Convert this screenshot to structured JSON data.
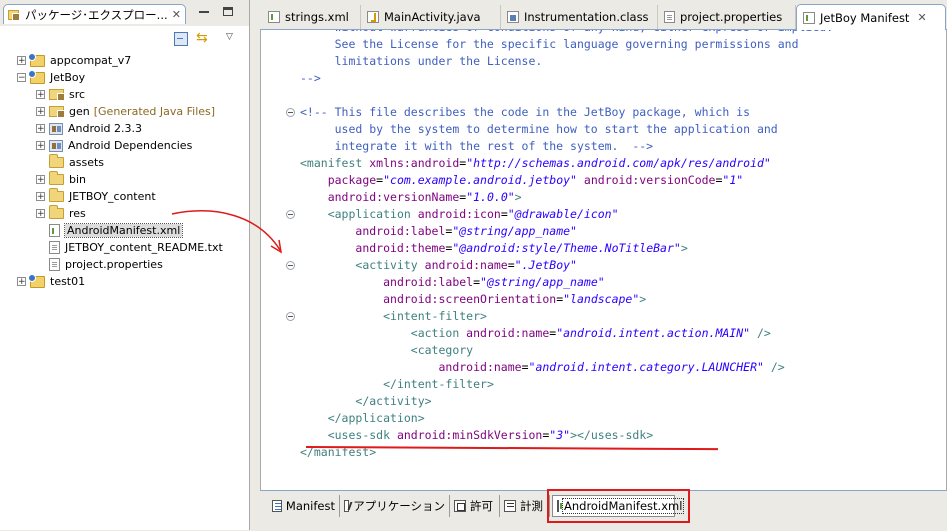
{
  "explorer": {
    "tab_title": "パッケージ･エクスプロー...",
    "tree": [
      {
        "label": "appcompat_v7",
        "kind": "project",
        "depth": 0,
        "expander": "+"
      },
      {
        "label": "JetBoy",
        "kind": "project",
        "depth": 0,
        "expander": "−"
      },
      {
        "label": "src",
        "kind": "pkgfolder",
        "depth": 1,
        "expander": "+"
      },
      {
        "label": "gen",
        "suffix": "[Generated Java Files]",
        "kind": "pkgfolder",
        "depth": 1,
        "expander": "+"
      },
      {
        "label": "Android 2.3.3",
        "kind": "library",
        "depth": 1,
        "expander": "+"
      },
      {
        "label": "Android Dependencies",
        "kind": "library",
        "depth": 1,
        "expander": "+"
      },
      {
        "label": "assets",
        "kind": "folder",
        "depth": 1,
        "expander": ""
      },
      {
        "label": "bin",
        "kind": "folder",
        "depth": 1,
        "expander": "+"
      },
      {
        "label": "JETBOY_content",
        "kind": "folder",
        "depth": 1,
        "expander": "+"
      },
      {
        "label": "res",
        "kind": "folder",
        "depth": 1,
        "expander": "+"
      },
      {
        "label": "AndroidManifest.xml",
        "kind": "xmlfile",
        "depth": 1,
        "expander": "",
        "selected": true
      },
      {
        "label": "JETBOY_content_README.txt",
        "kind": "file",
        "depth": 1,
        "expander": ""
      },
      {
        "label": "project.properties",
        "kind": "file",
        "depth": 1,
        "expander": ""
      },
      {
        "label": "test01",
        "kind": "project",
        "depth": 0,
        "expander": "+"
      }
    ]
  },
  "editor": {
    "tabs": [
      {
        "label": "strings.xml",
        "icon": "xml-file-icon"
      },
      {
        "label": "MainActivity.java",
        "icon": "java-file-icon"
      },
      {
        "label": "Instrumentation.class",
        "icon": "class-file-icon"
      },
      {
        "label": "project.properties",
        "icon": "properties-file-icon"
      },
      {
        "label": "JetBoy Manifest",
        "icon": "xml-file-icon",
        "active": true
      }
    ],
    "close_glyph": "✕",
    "bottom_tabs": [
      {
        "label": "Manifest",
        "icon": "manifest"
      },
      {
        "label": "アプリケーション",
        "icon": "application"
      },
      {
        "label": "許可",
        "icon": "permission"
      },
      {
        "label": "計測",
        "icon": "instrumentation"
      },
      {
        "label": "AndroidManifest.xml",
        "icon": "xml",
        "active": true
      }
    ]
  },
  "code_lines": [
    [
      [
        "c-com",
        "     without warranties or conditions of any kind, either express or implied."
      ]
    ],
    [
      [
        "c-com",
        "     See the License for the specific language governing permissions and"
      ]
    ],
    [
      [
        "c-com",
        "     limitations under the License."
      ]
    ],
    [
      [
        "c-com",
        "-->"
      ]
    ],
    [],
    [
      [
        "c-com",
        "<!-- This file describes the code in the JetBoy package, which is"
      ]
    ],
    [
      [
        "c-com",
        "     used by the system to determine how to start the application and"
      ]
    ],
    [
      [
        "c-com",
        "     integrate it with the rest of the system.  -->"
      ]
    ],
    [
      [
        "c-tag",
        "<manifest "
      ],
      [
        "c-attr",
        "xmlns:android"
      ],
      [
        "c-eq",
        "="
      ],
      [
        "c-val",
        "\"http://schemas.android.com/apk/res/android\""
      ]
    ],
    [
      [
        "",
        "    "
      ],
      [
        "c-attr",
        "package"
      ],
      [
        "c-eq",
        "="
      ],
      [
        "c-val",
        "\"com.example.android.jetboy\""
      ],
      [
        "",
        " "
      ],
      [
        "c-attr",
        "android:versionCode"
      ],
      [
        "c-eq",
        "="
      ],
      [
        "c-val",
        "\"1\""
      ]
    ],
    [
      [
        "",
        "    "
      ],
      [
        "c-attr",
        "android:versionName"
      ],
      [
        "c-eq",
        "="
      ],
      [
        "c-val",
        "\"1.0.0\""
      ],
      [
        "c-tag",
        ">"
      ]
    ],
    [
      [
        "",
        "    "
      ],
      [
        "c-tag",
        "<application "
      ],
      [
        "c-attr",
        "android:icon"
      ],
      [
        "c-eq",
        "="
      ],
      [
        "c-val",
        "\"@drawable/icon\""
      ]
    ],
    [
      [
        "",
        "        "
      ],
      [
        "c-attr",
        "android:label"
      ],
      [
        "c-eq",
        "="
      ],
      [
        "c-val",
        "\"@string/app_name\""
      ]
    ],
    [
      [
        "",
        "        "
      ],
      [
        "c-attr",
        "android:theme"
      ],
      [
        "c-eq",
        "="
      ],
      [
        "c-val",
        "\"@android:style/Theme.NoTitleBar\""
      ],
      [
        "c-tag",
        ">"
      ]
    ],
    [
      [
        "",
        "        "
      ],
      [
        "c-tag",
        "<activity "
      ],
      [
        "c-attr",
        "android:name"
      ],
      [
        "c-eq",
        "="
      ],
      [
        "c-val",
        "\".JetBoy\""
      ]
    ],
    [
      [
        "",
        "            "
      ],
      [
        "c-attr",
        "android:label"
      ],
      [
        "c-eq",
        "="
      ],
      [
        "c-val",
        "\"@string/app_name\""
      ]
    ],
    [
      [
        "",
        "            "
      ],
      [
        "c-attr",
        "android:screenOrientation"
      ],
      [
        "c-eq",
        "="
      ],
      [
        "c-val",
        "\"landscape\""
      ],
      [
        "c-tag",
        ">"
      ]
    ],
    [
      [
        "",
        "            "
      ],
      [
        "c-tag",
        "<intent-filter>"
      ]
    ],
    [
      [
        "",
        "                "
      ],
      [
        "c-tag",
        "<action "
      ],
      [
        "c-attr",
        "android:name"
      ],
      [
        "c-eq",
        "="
      ],
      [
        "c-val",
        "\"android.intent.action.MAIN\""
      ],
      [
        "c-tag",
        " />"
      ]
    ],
    [
      [
        "",
        "                "
      ],
      [
        "c-tag",
        "<category"
      ]
    ],
    [
      [
        "",
        "                    "
      ],
      [
        "c-attr",
        "android:name"
      ],
      [
        "c-eq",
        "="
      ],
      [
        "c-val",
        "\"android.intent.category.LAUNCHER\""
      ],
      [
        "c-tag",
        " />"
      ]
    ],
    [
      [
        "",
        "            "
      ],
      [
        "c-tag",
        "</intent-filter>"
      ]
    ],
    [
      [
        "",
        "        "
      ],
      [
        "c-tag",
        "</activity>"
      ]
    ],
    [
      [
        "",
        "    "
      ],
      [
        "c-tag",
        "</application>"
      ]
    ],
    [
      [
        "",
        "    "
      ],
      [
        "c-tag",
        "<uses-sdk "
      ],
      [
        "c-attr",
        "android:minSdkVersion"
      ],
      [
        "c-eq",
        "="
      ],
      [
        "c-val",
        "\"3\""
      ],
      [
        "c-tag",
        "></uses-sdk>"
      ]
    ],
    [
      [
        "c-tag",
        "</manifest>"
      ]
    ]
  ],
  "fold_markers_line_index": [
    5,
    11,
    14,
    17
  ],
  "colors": {
    "annotation_red": "#e0191a"
  }
}
